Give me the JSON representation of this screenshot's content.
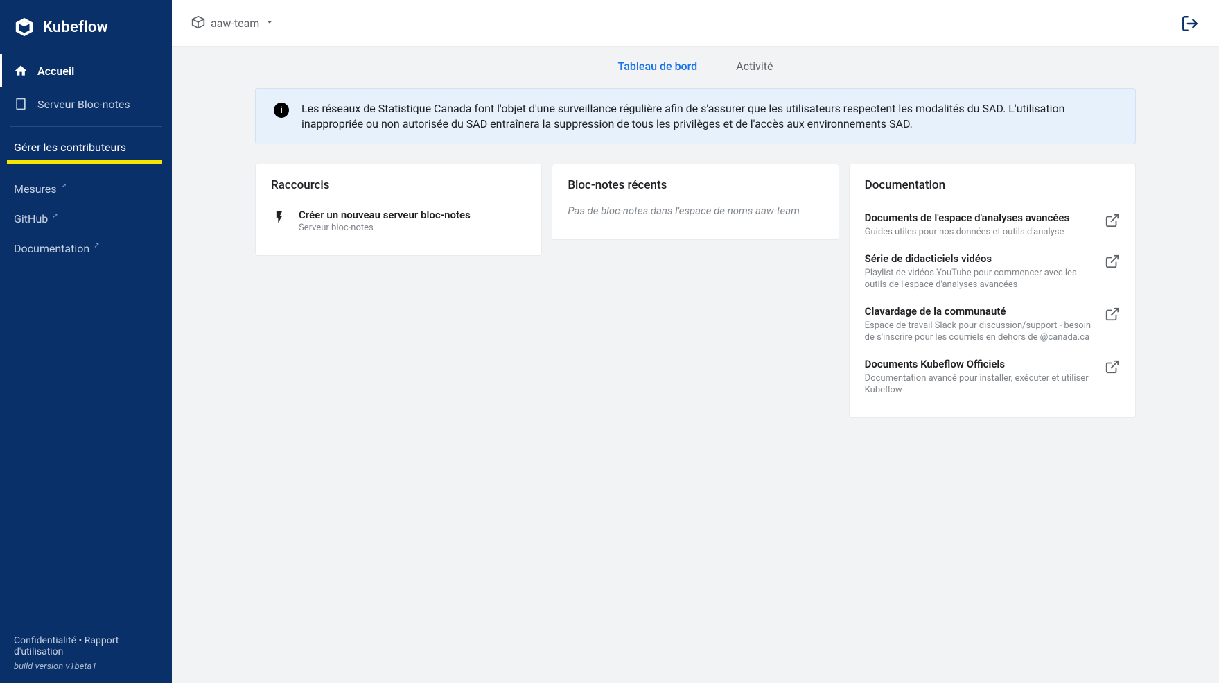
{
  "brand": "Kubeflow",
  "sidebar": {
    "items": [
      {
        "label": "Accueil"
      },
      {
        "label": "Serveur Bloc-notes"
      }
    ],
    "manage_contrib": "Gérer les contributeurs",
    "links": [
      {
        "label": "Mesures"
      },
      {
        "label": "GitHub"
      },
      {
        "label": "Documentation"
      }
    ],
    "footer": {
      "privacy": "Confidentialité",
      "sep": "•",
      "usage": "Rapport d'utilisation",
      "build": "build version v1beta1"
    }
  },
  "topbar": {
    "namespace": "aaw-team"
  },
  "tabs": {
    "dashboard": "Tableau de bord",
    "activity": "Activité"
  },
  "alert": {
    "text": "Les réseaux de Statistique Canada font l'objet d'une surveillance régulière afin de s'assurer que les utilisateurs respectent les modalités du SAD. L'utilisation inappropriée ou non autorisée du SAD entraînera la suppression de tous les privilèges et de l'accès aux environnements SAD."
  },
  "cards": {
    "shortcuts": {
      "header": "Raccourcis",
      "item": {
        "title": "Créer un nouveau serveur bloc-notes",
        "sub": "Serveur bloc-notes"
      }
    },
    "notebooks": {
      "header": "Bloc-notes récents",
      "empty": "Pas de bloc-notes dans l'espace de noms aaw-team"
    },
    "docs": {
      "header": "Documentation",
      "items": [
        {
          "title": "Documents de l'espace d'analyses avancées",
          "sub": "Guides utiles pour nos données et outils d'analyse"
        },
        {
          "title": "Série de didacticiels vidéos",
          "sub": "Playlist de vidéos YouTube pour commencer avec les outils de l'espace d'analyses avancées"
        },
        {
          "title": "Clavardage de la communauté",
          "sub": "Espace de travail Slack pour discussion/support - besoin de s'inscrire pour les courriels en dehors de @canada.ca"
        },
        {
          "title": "Documents Kubeflow Officiels",
          "sub": "Documentation avancé pour installer, exécuter et utiliser Kubeflow"
        }
      ]
    }
  }
}
